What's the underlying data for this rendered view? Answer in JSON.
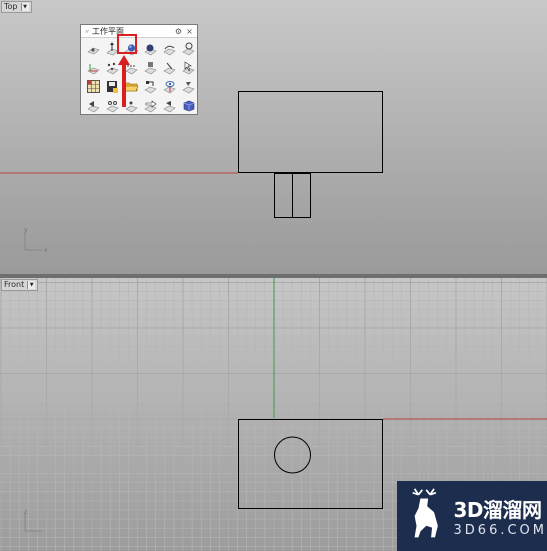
{
  "viewports": {
    "top": {
      "label": "Top"
    },
    "front": {
      "label": "Front"
    }
  },
  "axes": {
    "y": "y",
    "x": "x",
    "z": "z"
  },
  "panel": {
    "title": "工作平面",
    "settings_icon": "gear-icon",
    "close_label": "×",
    "highlighted_tool": "construction-plane-tool",
    "highlight_color": "#d92020"
  },
  "watermark": {
    "line1": "3D溜溜网",
    "line2": "3D66.COM",
    "bg": "#1d2d4e"
  },
  "colors": {
    "x_axis": "#b84040",
    "y_axis": "#3aa040",
    "outline": "#000000"
  }
}
